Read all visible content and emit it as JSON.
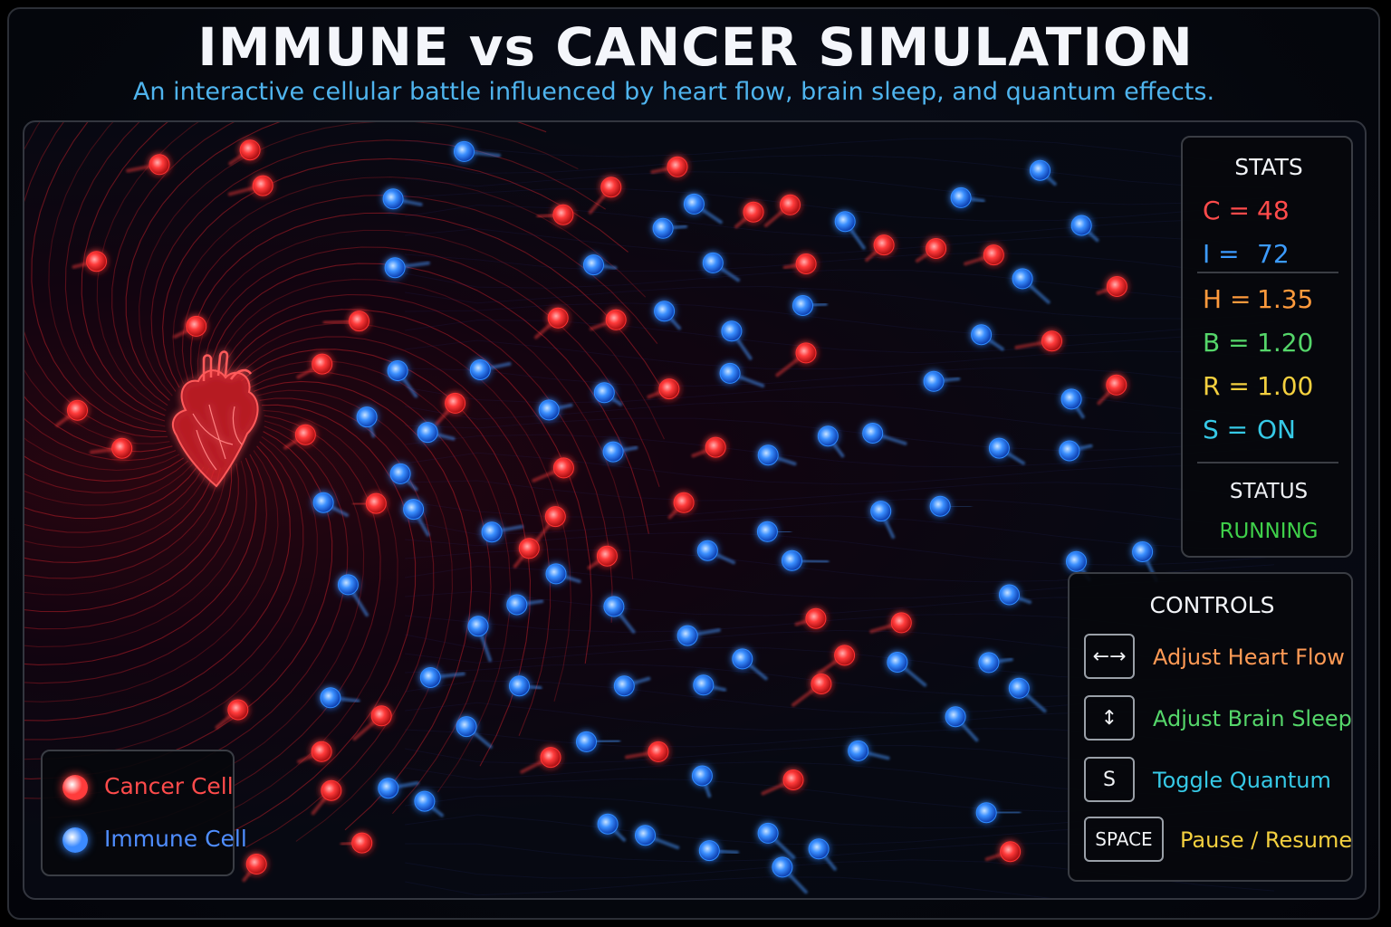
{
  "header": {
    "title": "IMMUNE vs CANCER SIMULATION",
    "subtitle": "An interactive cellular battle influenced by heart flow, brain sleep, and quantum effects."
  },
  "stats": {
    "title": "STATS",
    "items": [
      {
        "label": "C =",
        "value": "48",
        "color": "#ff4b4b"
      },
      {
        "label": "I =",
        "value": "72",
        "color": "#3c9bff"
      },
      {
        "label": "H =",
        "value": "1.35",
        "color": "#ff9a3c"
      },
      {
        "label": "B =",
        "value": "1.20",
        "color": "#55d66a"
      },
      {
        "label": "R =",
        "value": "1.00",
        "color": "#f4d03f"
      },
      {
        "label": "S =",
        "value": "ON",
        "color": "#36c9e6"
      }
    ],
    "status_title": "STATUS",
    "status_value": "RUNNING"
  },
  "controls": {
    "title": "CONTROLS",
    "items": [
      {
        "key": "←→",
        "label": "Adjust Heart Flow",
        "color": "#ff9a55",
        "icon": "left-right-arrows-icon"
      },
      {
        "key": "↕",
        "label": "Adjust Brain Sleep",
        "color": "#55d66a",
        "icon": "up-down-arrow-icon"
      },
      {
        "key": "S",
        "label": "Toggle Quantum",
        "color": "#36c9e6",
        "icon": "s-key-icon"
      },
      {
        "key": "SPACE",
        "label": "Pause / Resume",
        "color": "#f4d03f",
        "icon": "space-key-icon"
      }
    ]
  },
  "legend": {
    "items": [
      {
        "label": "Cancer Cell",
        "color": "#ff3b3b",
        "text_color": "#ff4b4b"
      },
      {
        "label": "Immune Cell",
        "color": "#3c8bff",
        "text_color": "#4f8dff"
      }
    ]
  },
  "colors": {
    "cancer": "#ff3333",
    "immune": "#2f8cff",
    "heart": "#ff2a2a"
  },
  "icons": {
    "heart": "anatomical-heart-icon"
  }
}
